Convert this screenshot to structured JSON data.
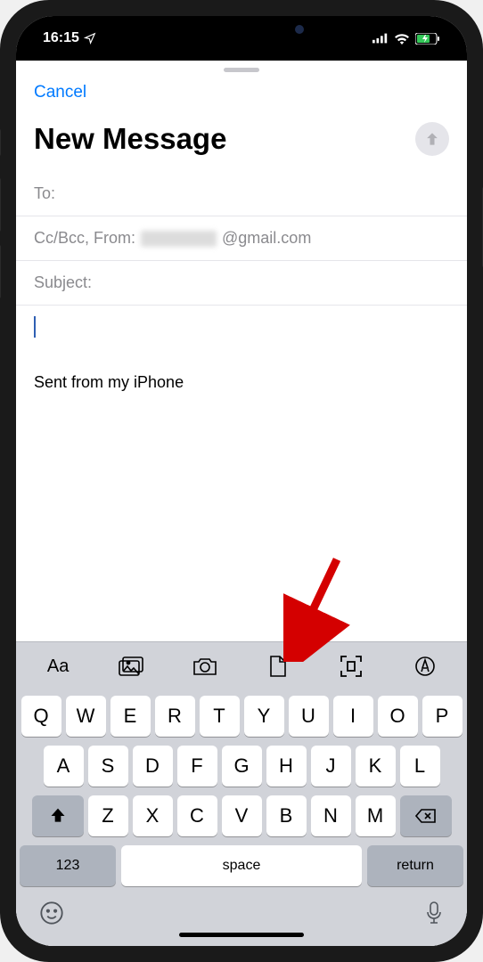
{
  "status": {
    "time": "16:15",
    "signal_icon": "signal-icon",
    "wifi_icon": "wifi-icon",
    "battery_icon": "battery-charging-icon"
  },
  "compose": {
    "cancel_label": "Cancel",
    "title": "New Message",
    "to_label": "To:",
    "cc_label": "Cc/Bcc, From:",
    "from_value_suffix": "@gmail.com",
    "subject_label": "Subject:",
    "signature": "Sent from my iPhone"
  },
  "toolbar": {
    "format": "Aa",
    "photos": "photo-library-icon",
    "camera": "camera-icon",
    "document": "document-icon",
    "scan": "scan-document-icon",
    "markup": "markup-icon"
  },
  "keyboard": {
    "row1": [
      "Q",
      "W",
      "E",
      "R",
      "T",
      "Y",
      "U",
      "I",
      "O",
      "P"
    ],
    "row2": [
      "A",
      "S",
      "D",
      "F",
      "G",
      "H",
      "J",
      "K",
      "L"
    ],
    "row3": [
      "Z",
      "X",
      "C",
      "V",
      "B",
      "N",
      "M"
    ],
    "fn_label": "123",
    "space_label": "space",
    "return_label": "return"
  }
}
